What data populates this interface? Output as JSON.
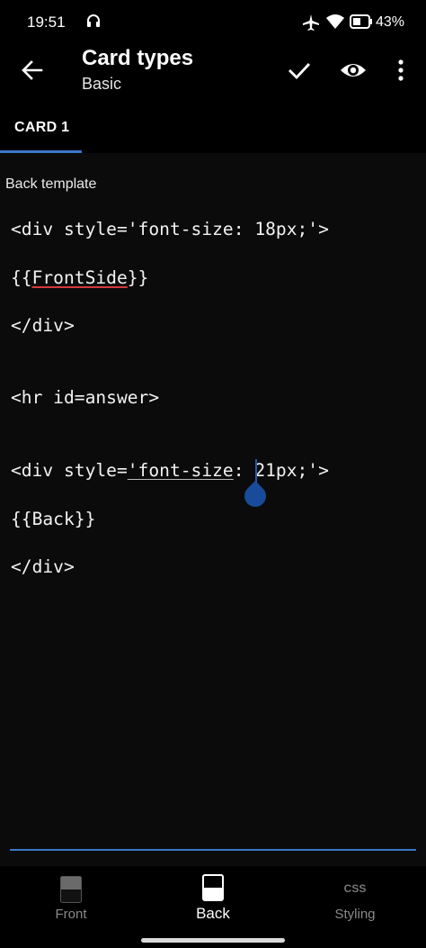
{
  "status_bar": {
    "time": "19:51",
    "battery_pct": "43%",
    "icons": [
      "headphones-icon",
      "airplane-icon",
      "wifi-icon",
      "battery-icon"
    ]
  },
  "app_bar": {
    "title": "Card types",
    "subtitle": "Basic",
    "back_icon": "back-arrow-icon",
    "actions": [
      "check-icon",
      "eye-icon",
      "more-vert-icon"
    ]
  },
  "tabs": [
    {
      "label": "CARD 1",
      "selected": true
    }
  ],
  "editor": {
    "label": "Back template",
    "lines": [
      "<div style='font-size: 18px;'>",
      "{{FrontSide}}",
      "</div>",
      "",
      "<hr id=answer>",
      "",
      "<div style='font-size: 21px;'>",
      "{{Back}}",
      "</div>"
    ],
    "l1": "<div style='font-size: 18px;'>",
    "l2_pre": "{{",
    "l2_word": "FrontSide",
    "l2_post": "}}",
    "l3": "</div>",
    "l5": "<hr id=answer>",
    "l7_pre": "<div style=",
    "l7_mid": "'font-size",
    "l7_post": ": 21px;'>",
    "l8": "{{Back}}",
    "l9": "</div>"
  },
  "bottom_nav": {
    "front_label": "Front",
    "back_label": "Back",
    "styling_label": "Styling",
    "styling_icon_text": "CSS",
    "selected": "Back"
  },
  "colors": {
    "accent": "#3a78c8",
    "background": "#0b0b0b",
    "bar": "#000000",
    "spell_error": "#d33a3a"
  }
}
